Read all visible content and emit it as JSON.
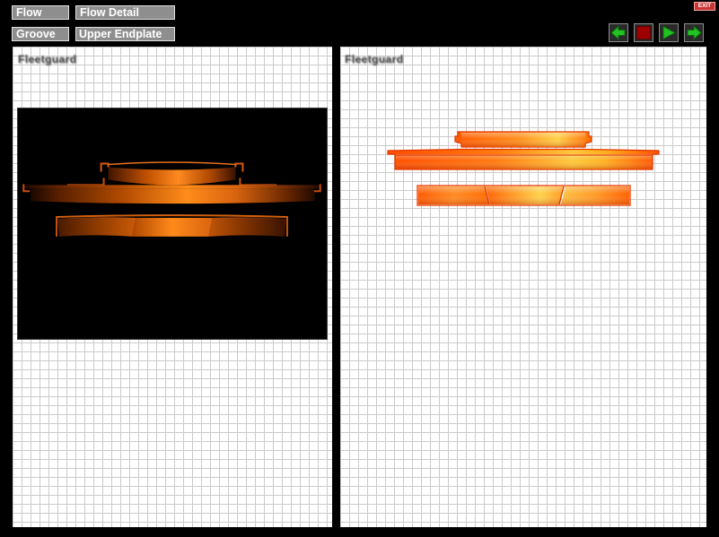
{
  "nav_buttons": [
    {
      "label": "Flow"
    },
    {
      "label": "Flow Detail"
    },
    {
      "label": "Groove"
    },
    {
      "label": "Upper Endplate"
    }
  ],
  "exit": {
    "label": "EXIT"
  },
  "controls": [
    {
      "icon": "arrow-left-icon"
    },
    {
      "icon": "stop-icon"
    },
    {
      "icon": "play-icon"
    },
    {
      "icon": "arrow-right-icon"
    }
  ],
  "left_panel": {
    "watermark": "Fleetguard"
  },
  "right_panel": {
    "watermark": "Fleetguard"
  },
  "colors": {
    "accent_green": "#22c322",
    "stop_red": "#9e0000",
    "exit_red": "#cc3333",
    "part_orange": "#ff6a00",
    "part_highlight": "#ffd048"
  }
}
